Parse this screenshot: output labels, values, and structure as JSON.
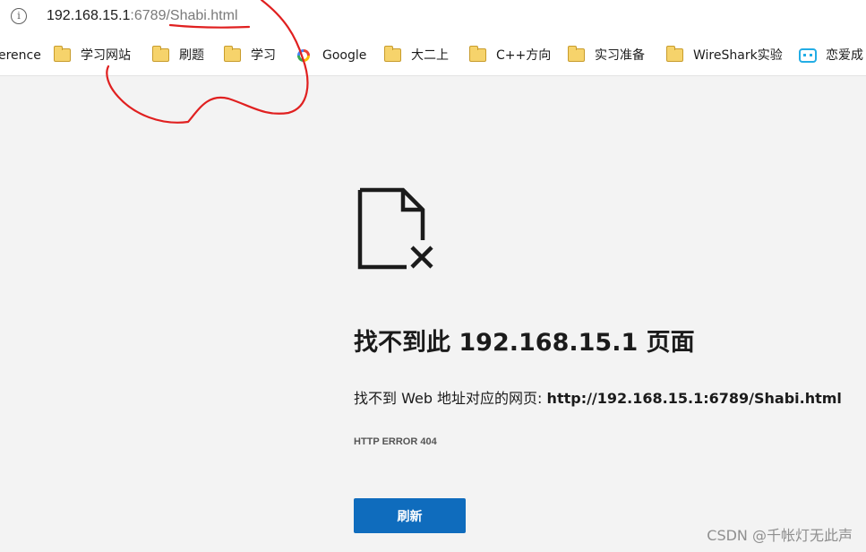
{
  "address_bar": {
    "url_host": "192.168.15.1",
    "url_rest": ":6789/Shabi.html"
  },
  "bookmarks": [
    {
      "label": "erence",
      "icon": "none"
    },
    {
      "label": "学习网站",
      "icon": "folder-icon"
    },
    {
      "label": "刷题",
      "icon": "folder-icon"
    },
    {
      "label": "学习",
      "icon": "folder-icon"
    },
    {
      "label": "Google",
      "icon": "google-icon"
    },
    {
      "label": "大二上",
      "icon": "folder-icon"
    },
    {
      "label": "C++方向",
      "icon": "folder-icon"
    },
    {
      "label": "实习准备",
      "icon": "folder-icon"
    },
    {
      "label": "WireShark实验",
      "icon": "folder-icon"
    },
    {
      "label": "恋爱成",
      "icon": "bilibili-icon"
    }
  ],
  "error": {
    "title": "找不到此 192.168.15.1 页面",
    "desc_prefix": "找不到 Web 地址对应的网页: ",
    "desc_url": "http://192.168.15.1:6789/Shabi.html",
    "code": "HTTP ERROR 404",
    "refresh_label": "刷新"
  },
  "watermark": "CSDN @千帐灯无此声",
  "colors": {
    "accent": "#0f6cbd",
    "annotation": "#e02020",
    "page_bg": "#f3f3f3"
  }
}
